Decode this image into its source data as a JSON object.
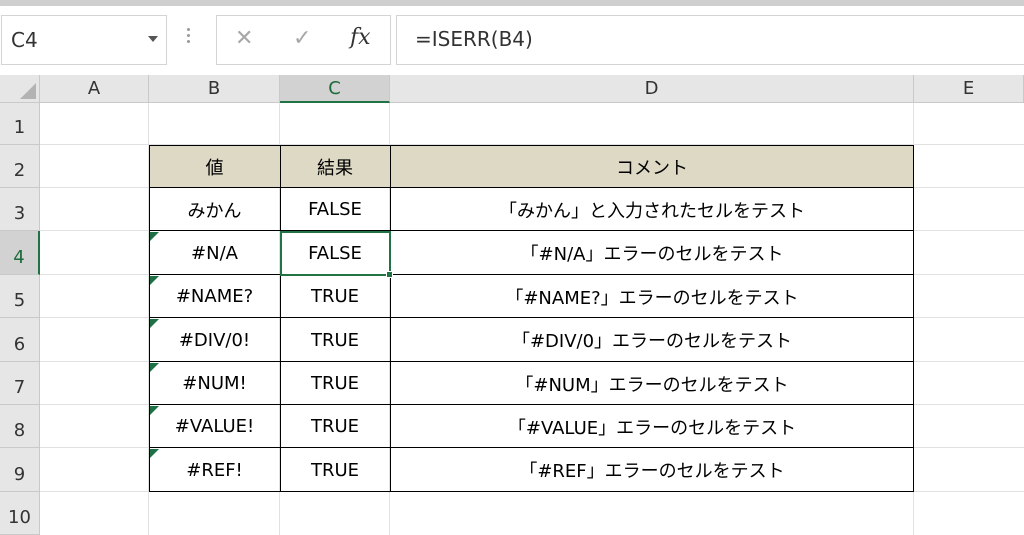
{
  "formula_bar": {
    "name_box": "C4",
    "cancel_icon": "✕",
    "enter_icon": "✓",
    "fx_label": "fx",
    "formula": "=ISERR(B4)"
  },
  "columns": [
    "A",
    "B",
    "C",
    "D",
    "E"
  ],
  "selected_column": "C",
  "rows": [
    "1",
    "2",
    "3",
    "4",
    "5",
    "6",
    "7",
    "8",
    "9",
    "10"
  ],
  "selected_row": "4",
  "selected_cell": "C4",
  "table": {
    "headers": [
      "値",
      "結果",
      "コメント"
    ],
    "header_fill": "#ddd9c4",
    "error_indicator_color": "#1e7145",
    "rows": [
      {
        "value": "みかん",
        "result": "FALSE",
        "comment": "「みかん」と入力されたセルをテスト",
        "error_indicator": false
      },
      {
        "value": "#N/A",
        "result": "FALSE",
        "comment": "「#N/A」エラーのセルをテスト",
        "error_indicator": true
      },
      {
        "value": "#NAME?",
        "result": "TRUE",
        "comment": "「#NAME?」エラーのセルをテスト",
        "error_indicator": true
      },
      {
        "value": "#DIV/0!",
        "result": "TRUE",
        "comment": "「#DIV/0」エラーのセルをテスト",
        "error_indicator": true
      },
      {
        "value": "#NUM!",
        "result": "TRUE",
        "comment": "「#NUM」エラーのセルをテスト",
        "error_indicator": true
      },
      {
        "value": "#VALUE!",
        "result": "TRUE",
        "comment": "「#VALUE」エラーのセルをテスト",
        "error_indicator": true
      },
      {
        "value": "#REF!",
        "result": "TRUE",
        "comment": "「#REF」エラーのセルをテスト",
        "error_indicator": true
      }
    ]
  },
  "accent_color": "#217346"
}
